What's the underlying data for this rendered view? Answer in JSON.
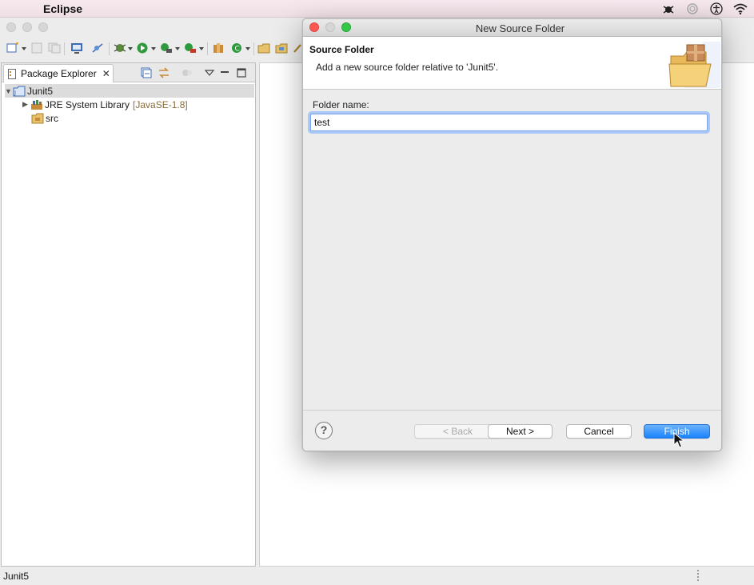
{
  "menubar": {
    "app_name": "Eclipse"
  },
  "explorer": {
    "tab_label": "Package Explorer",
    "tree": {
      "project": "Junit5",
      "jre_label": "JRE System Library",
      "jre_decoration": "[JavaSE-1.8]",
      "src": "src"
    }
  },
  "status": {
    "text": "Junit5"
  },
  "dialog": {
    "title": "New Source Folder",
    "banner_title": "Source Folder",
    "banner_message": "Add a new source folder relative to 'Junit5'.",
    "folder_label": "Folder name:",
    "folder_value": "test",
    "help_glyph": "?",
    "buttons": {
      "back": "< Back",
      "next": "Next >",
      "cancel": "Cancel",
      "finish": "Finish"
    }
  },
  "colors": {
    "close": "#fc5753",
    "minimize": "#d6d6d6",
    "zoom": "#33c748",
    "primary_button": "#1a82fb",
    "focus_ring": "#a9c8f5"
  },
  "icons": {
    "menubar": [
      "apple-icon",
      "bug-icon",
      "spinner-icon",
      "accessibility-icon",
      "wifi-icon"
    ],
    "banner": "package-folder-icon"
  }
}
